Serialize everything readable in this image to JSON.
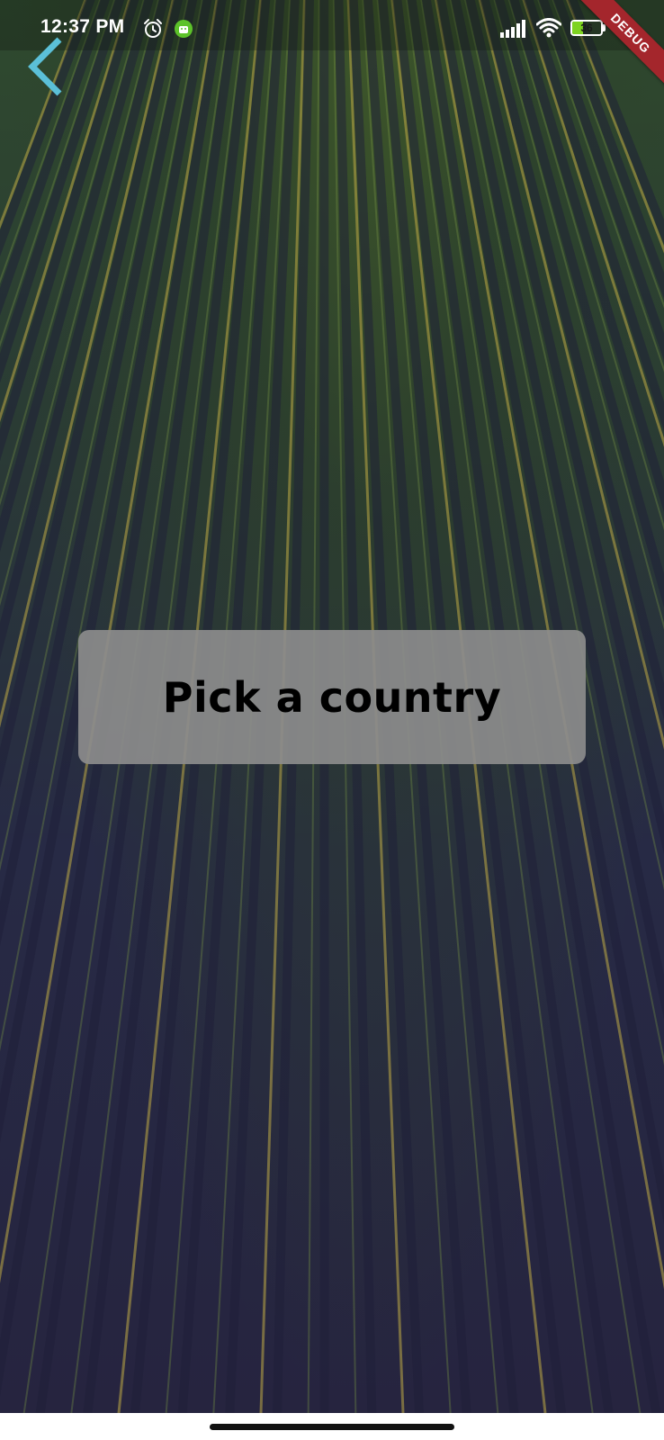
{
  "status_bar": {
    "time": "12:37 PM",
    "battery_level": "36",
    "battery_fraction": 0.36,
    "alarm_icon": "alarm-clock-icon",
    "app_icon": "android-notification-icon",
    "signal_icon": "cell-signal-icon",
    "wifi_icon": "wifi-icon"
  },
  "debug_banner": {
    "label": "DEBUG"
  },
  "header": {
    "back_icon": "chevron-left-icon",
    "back_color": "#5bc0d8"
  },
  "main": {
    "card_title": "Pick a country"
  },
  "colors": {
    "card_background": "#8c8c8c",
    "banner": "#a4262c",
    "battery_fill": "#7ed321"
  }
}
